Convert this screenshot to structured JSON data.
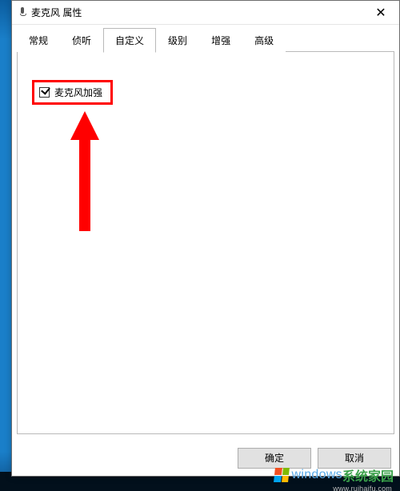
{
  "window": {
    "title": "麦克风 属性",
    "close_glyph": "✕"
  },
  "tabs": [
    {
      "label": "常规",
      "active": false
    },
    {
      "label": "侦听",
      "active": false
    },
    {
      "label": "自定义",
      "active": true
    },
    {
      "label": "级别",
      "active": false
    },
    {
      "label": "增强",
      "active": false
    },
    {
      "label": "高级",
      "active": false
    }
  ],
  "custom_panel": {
    "mic_boost": {
      "label": "麦克风加强",
      "checked": true
    }
  },
  "buttons": {
    "ok": "确定",
    "cancel": "取消"
  },
  "watermark": {
    "brand_en": "windows",
    "brand_cn": "系统家园",
    "url": "www.ruihaifu.com"
  }
}
